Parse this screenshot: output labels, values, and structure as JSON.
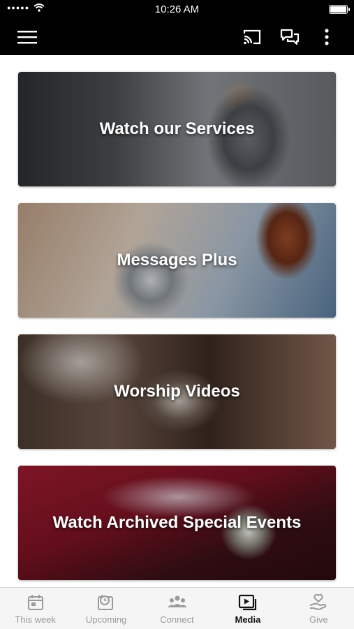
{
  "status": {
    "time": "10:26 AM"
  },
  "cards": [
    {
      "title": "Watch our Services"
    },
    {
      "title": "Messages Plus"
    },
    {
      "title": "Worship Videos"
    },
    {
      "title": "Watch Archived Special Events"
    }
  ],
  "tabs": [
    {
      "label": "This week",
      "icon": "calendar-icon",
      "active": false
    },
    {
      "label": "Upcoming",
      "icon": "calendar-clock-icon",
      "active": false
    },
    {
      "label": "Connect",
      "icon": "people-icon",
      "active": false
    },
    {
      "label": "Media",
      "icon": "play-media-icon",
      "active": true
    },
    {
      "label": "Give",
      "icon": "hand-heart-icon",
      "active": false
    }
  ],
  "colors": {
    "app_bar": "#000000",
    "tab_active": "#111111",
    "tab_inactive": "#9a9a9a"
  }
}
